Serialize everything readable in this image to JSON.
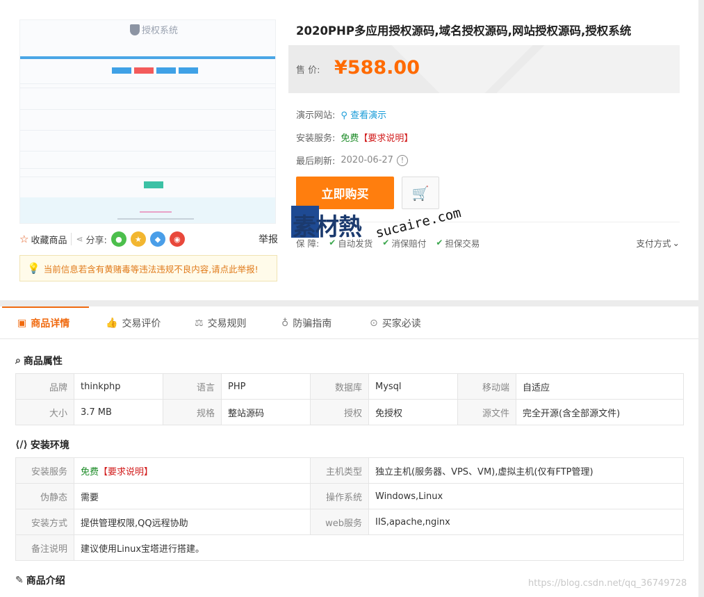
{
  "product": {
    "title": "2020PHP多应用授权源码,域名授权源码,网站授权源码,授权系统",
    "price_label": "售  价:",
    "price": "¥588.00",
    "demo_label": "演示网站:",
    "demo_link": "查看演示",
    "install_label": "安装服务:",
    "install_free": "免费",
    "install_note": "【要求说明】",
    "refresh_label": "最后刷新:",
    "refresh_date": "2020-06-27",
    "buy_label": "立即购买",
    "guarantee_label": "保  障:",
    "guarantees": [
      "自动发货",
      "消保赔付",
      "担保交易"
    ],
    "payment_label": "支付方式"
  },
  "thumbnail": {
    "logo_text": "授权系统"
  },
  "actions": {
    "favorite": "收藏商品",
    "share": "分享:",
    "report": "举报",
    "share_colors": [
      "#4cbf4c",
      "#f2b630",
      "#4a9ee8",
      "#e8483b"
    ]
  },
  "notice": "当前信息若含有黄赌毒等违法违规不良内容,请点此举报!",
  "watermark": {
    "cn": "素材熱",
    "en": "sucaire.com"
  },
  "tabs": [
    {
      "label": "商品详情",
      "icon": "detail-icon"
    },
    {
      "label": "交易评价",
      "icon": "thumb-up-icon"
    },
    {
      "label": "交易规则",
      "icon": "scale-icon"
    },
    {
      "label": "防骗指南",
      "icon": "bulb-icon"
    },
    {
      "label": "买家必读",
      "icon": "target-icon"
    }
  ],
  "attributes": {
    "title": "商品属性",
    "rows": [
      [
        [
          "品牌",
          "thinkphp"
        ],
        [
          "语言",
          "PHP"
        ],
        [
          "数据库",
          "Mysql"
        ],
        [
          "移动端",
          "自适应"
        ]
      ],
      [
        [
          "大小",
          "3.7 MB"
        ],
        [
          "规格",
          "整站源码"
        ],
        [
          "授权",
          "免授权"
        ],
        [
          "源文件",
          "完全开源(含全部源文件)"
        ]
      ]
    ]
  },
  "environment": {
    "title": "安装环境",
    "install_service_label": "安装服务",
    "install_service_free": "免费",
    "install_service_note": "【要求说明】",
    "host_label": "主机类型",
    "host_value": "独立主机(服务器、VPS、VM),虚拟主机(仅有FTP管理)",
    "rewrite_label": "伪静态",
    "rewrite_value": "需要",
    "os_label": "操作系统",
    "os_value": "Windows,Linux",
    "method_label": "安装方式",
    "method_value": "提供管理权限,QQ远程协助",
    "web_label": "web服务",
    "web_value": "IIS,apache,nginx",
    "remark_label": "备注说明",
    "remark_value": "建议使用Linux宝塔进行搭建。"
  },
  "intro": {
    "title": "商品介绍"
  },
  "csdn_watermark": "https://blog.csdn.net/qq_36749728"
}
